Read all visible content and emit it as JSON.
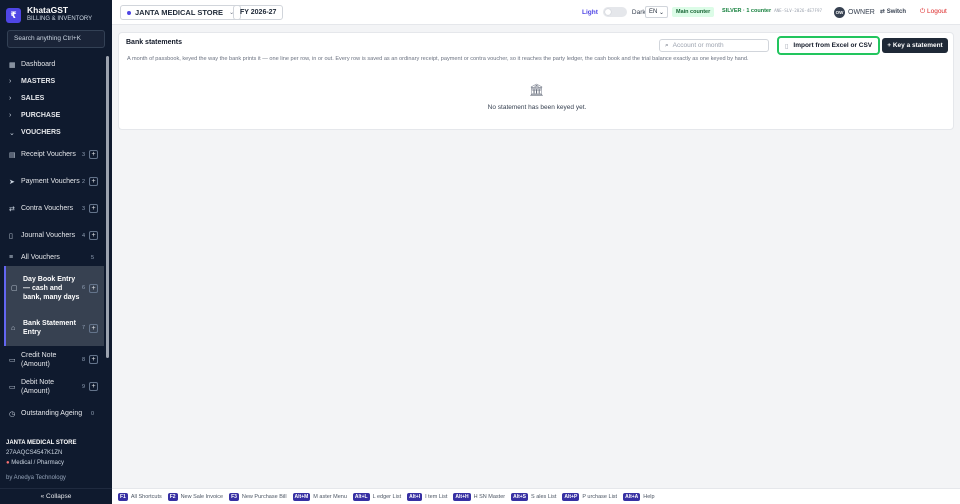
{
  "app": {
    "name": "KhataGST",
    "subtitle": "BILLING & INVENTORY",
    "logo_glyph": "₹",
    "brand_color": "#4f46e5"
  },
  "sidebar": {
    "search_text": "Search anything  Ctrl+K",
    "items": [
      {
        "label": "Dashboard",
        "icon": "grid-icon"
      },
      {
        "label": "MASTERS",
        "icon": "chevron-right-icon"
      },
      {
        "label": "SALES",
        "icon": "chevron-right-icon"
      },
      {
        "label": "PURCHASE",
        "icon": "chevron-right-icon"
      },
      {
        "label": "VOUCHERS",
        "icon": "chevron-down-icon"
      },
      {
        "label": "Receipt Vouchers",
        "count": "3",
        "icon": "receipt-icon"
      },
      {
        "label": "Payment Vouchers",
        "count": "2",
        "icon": "send-icon"
      },
      {
        "label": "Contra Vouchers",
        "count": "3",
        "icon": "swap-icon"
      },
      {
        "label": "Journal Vouchers",
        "count": "4",
        "icon": "book-icon"
      },
      {
        "label": "All Vouchers",
        "count": "5",
        "icon": "list-icon"
      },
      {
        "label": "Day Book Entry — cash and bank, many days",
        "count": "6",
        "icon": "book-open-icon"
      },
      {
        "label": "Bank Statement Entry",
        "count": "7",
        "icon": "bank-icon"
      },
      {
        "label": "Credit Note (Amount)",
        "count": "8",
        "icon": "note-icon"
      },
      {
        "label": "Debit Note (Amount)",
        "count": "9",
        "icon": "note-icon"
      },
      {
        "label": "Outstanding Ageing",
        "count": "0",
        "icon": "clock-icon"
      }
    ],
    "store_name": "JANTA MEDICAL STORE",
    "gstin": "27AAQCS4547K1ZN",
    "store_type": "Medical / Pharmacy",
    "by": "by Anedya Technology",
    "collapse_label": "« Collapse"
  },
  "topbar": {
    "store": "JANTA MEDICAL STORE",
    "fy": "FY 2026-27",
    "theme_light": "Light",
    "theme_dark": "Dark",
    "lang": "EN",
    "counter": "Main counter",
    "plan": "SILVER · 1 counter",
    "plan_code": "ANE-SLV-2026-4E7F97",
    "avatar": "OW",
    "role": "OWNER",
    "switch": "Switch",
    "logout": "Logout"
  },
  "main": {
    "title": "Bank statements",
    "description": "A month of passbook, keyed the way the bank prints it — one line per row, in or out. Every row is saved as an ordinary receipt, payment or contra voucher, so it reaches the party ledger, the cash book and the trial balance exactly as one keyed by hand.",
    "search_placeholder": "Account or month",
    "import_label": "Import from Excel or CSV",
    "key_label": "+ Key a statement",
    "empty_text": "No statement has been keyed yet."
  },
  "shortcuts": [
    {
      "key": "F1",
      "label": "All Shortcuts"
    },
    {
      "key": "F2",
      "label": "New Sale Invoice"
    },
    {
      "key": "F3",
      "label": "New Purchase Bill"
    },
    {
      "key": "Alt+M",
      "label": "M aster Menu"
    },
    {
      "key": "Alt+L",
      "label": "L edger List"
    },
    {
      "key": "Alt+I",
      "label": "I tem List"
    },
    {
      "key": "Alt+H",
      "label": "H SN Master"
    },
    {
      "key": "Alt+S",
      "label": "S ales List"
    },
    {
      "key": "Alt+P",
      "label": "P urchase List"
    },
    {
      "key": "Alt+A",
      "label": "Help"
    }
  ],
  "colors": {
    "accent": "#4f46e5",
    "sidebar_bg": "#0f1a2e",
    "highlight": "#22c55e",
    "logout": "#dc2626"
  }
}
